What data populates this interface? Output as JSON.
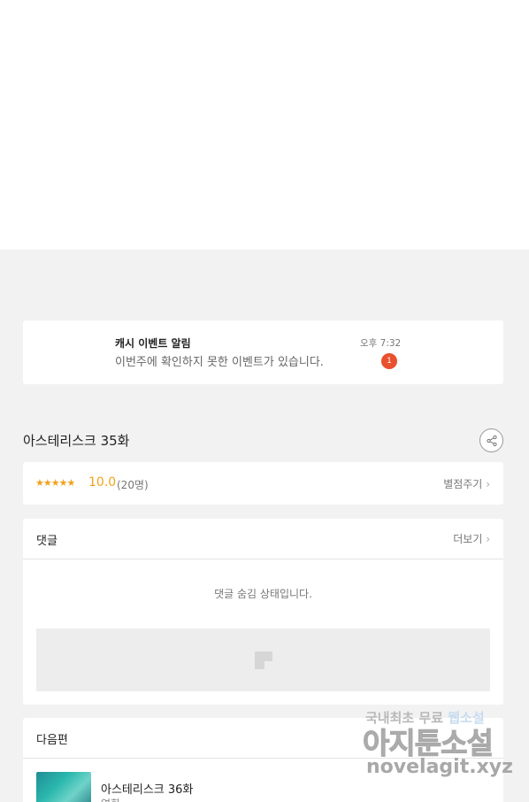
{
  "notification": {
    "title": "캐시 이벤트 알림",
    "message": "이번주에 확인하지 못한 이벤트가 있습니다.",
    "time": "오후 7:32",
    "badge_count": "1"
  },
  "episode": {
    "title": "아스테리스크 35화",
    "share_icon": "share-icon"
  },
  "rating": {
    "stars": "★★★★★",
    "score": "10.0",
    "count": "(20명)",
    "rate_link": "별점주기",
    "star_color": "#f1a21c"
  },
  "comments": {
    "title": "댓글",
    "more_link": "더보기",
    "hidden_message": "댓글 숨김 상태입니다."
  },
  "next_episode": {
    "section_title": "다음편",
    "episode_title": "아스테리스크 36화",
    "subtitle": "연화"
  },
  "watermark": {
    "line1_a": "국내최초 무료 ",
    "line1_b": "웹소설",
    "line2": "아지툰소설",
    "line3": "novelagit.xyz"
  },
  "colors": {
    "badge": "#e8502e",
    "background": "#f2f2f2"
  }
}
